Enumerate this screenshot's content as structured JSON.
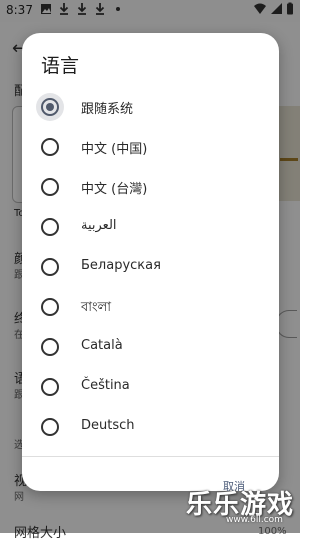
{
  "status_bar": {
    "time": "8:37"
  },
  "background": {
    "item_labels": [
      "配",
      "To",
      "颜",
      "跟",
      "终",
      "在",
      "语",
      "跟",
      "选",
      "视",
      "网",
      "网格大小"
    ],
    "page_bottom_value": "100%"
  },
  "dialog": {
    "title": "语言",
    "options": [
      {
        "label": "跟随系统",
        "selected": true
      },
      {
        "label": "中文 (中国)",
        "selected": false
      },
      {
        "label": "中文 (台灣)",
        "selected": false
      },
      {
        "label": "العربية",
        "selected": false
      },
      {
        "label": "Беларуская",
        "selected": false
      },
      {
        "label": "বাংলা",
        "selected": false
      },
      {
        "label": "Català",
        "selected": false
      },
      {
        "label": "Čeština",
        "selected": false
      },
      {
        "label": "Deutsch",
        "selected": false
      }
    ],
    "cancel_label": "取消"
  },
  "watermark": {
    "text": "乐乐游戏",
    "url": "www.6ll.com"
  },
  "colors": {
    "accent": "#50596b",
    "scrim": "rgba(0,0,0,0.42)"
  }
}
